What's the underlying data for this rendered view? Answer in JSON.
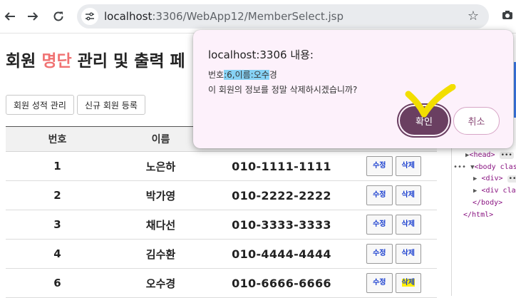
{
  "browser": {
    "url_host": "localhost",
    "url_rest": ":3306/WebApp12/MemberSelect.jsp"
  },
  "page": {
    "title_prefix": "회원 ",
    "title_accent": "명단",
    "title_suffix": " 관리 및 출력 페",
    "buttons": {
      "scores": "회원 성적 관리",
      "register": "신규 회원 등록"
    },
    "table": {
      "headers": {
        "no": "번호",
        "name": "이름"
      },
      "rows": [
        {
          "no": "1",
          "name": "노은하",
          "phone": "010-1111-1111",
          "edit": "수정",
          "delete": "삭제"
        },
        {
          "no": "2",
          "name": "박가영",
          "phone": "010-2222-2222",
          "edit": "수정",
          "delete": "삭제"
        },
        {
          "no": "3",
          "name": "채다선",
          "phone": "010-3333-3333",
          "edit": "수정",
          "delete": "삭제"
        },
        {
          "no": "4",
          "name": "김수환",
          "phone": "010-4444-4444",
          "edit": "수정",
          "delete": "삭제"
        },
        {
          "no": "6",
          "name": "오수경",
          "phone": "010-6666-6666",
          "edit": "수정",
          "delete": "삭제"
        }
      ]
    }
  },
  "dialog": {
    "title": "localhost:3306 내용:",
    "message_line1_prefix": "번호",
    "message_line1_selected": ":6,이름:오수",
    "message_line1_suffix": "경",
    "message_line2": "이 회원의 정보를 정말 삭제하시겠습니까?",
    "ok_label": "확인",
    "cancel_label": "취소"
  },
  "devtools": {
    "head_tag": "<head>",
    "body_tag": "<body clas",
    "div_tag_1": "<div>",
    "div_tag_2": "<div cla",
    "close_body": "</body>",
    "close_html": "</html>",
    "ellipsis": "•••",
    "dots": "•••"
  },
  "colors": {
    "accent": "#f07272",
    "dialog_bg": "#fdf1fb",
    "ok_button": "#6a3f61",
    "selection": "#86d2f5",
    "highlight": "#ffef00"
  }
}
